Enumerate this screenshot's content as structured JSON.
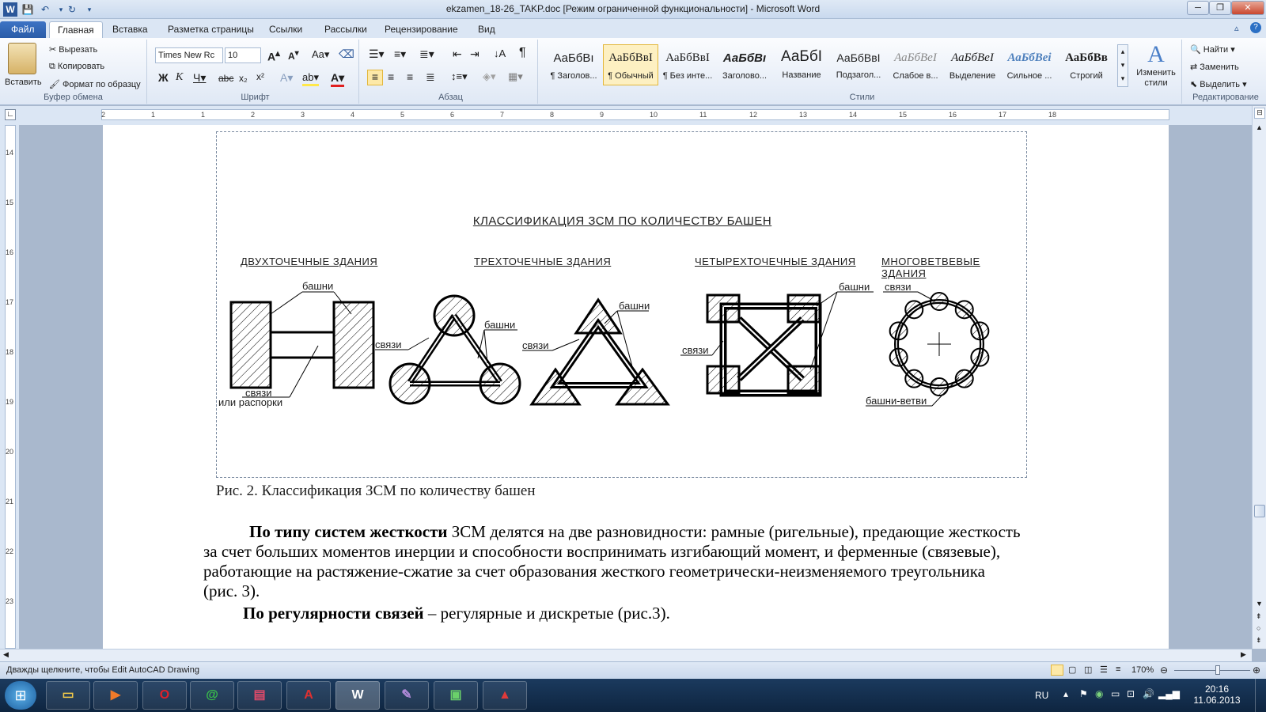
{
  "window": {
    "title": "ekzamen_18-26_TAKP.doc [Режим ограниченной функциональности]  -  Microsoft Word"
  },
  "tabs": [
    "Файл",
    "Главная",
    "Вставка",
    "Разметка страницы",
    "Ссылки",
    "Рассылки",
    "Рецензирование",
    "Вид"
  ],
  "clipboard": {
    "paste": "Вставить",
    "cut": "Вырезать",
    "copy": "Копировать",
    "format": "Формат по образцу",
    "label": "Буфер обмена"
  },
  "font": {
    "name": "Times New Rc",
    "size": "10",
    "label": "Шрифт"
  },
  "paragraph": {
    "label": "Абзац"
  },
  "styles": {
    "label": "Стили",
    "change": "Изменить стили",
    "items": [
      {
        "sample": "АаБбВı",
        "name": "¶ Заголов..."
      },
      {
        "sample": "АаБбВвI",
        "name": "¶ Обычный"
      },
      {
        "sample": "АаБбВвI",
        "name": "¶ Без инте..."
      },
      {
        "sample": "АаБбВı",
        "name": "Заголово..."
      },
      {
        "sample": "АаБбI",
        "name": "Название"
      },
      {
        "sample": "АаБбВвI",
        "name": "Подзагол..."
      },
      {
        "sample": "АаБбВеI",
        "name": "Слабое в..."
      },
      {
        "sample": "АаБбВеI",
        "name": "Выделение"
      },
      {
        "sample": "АаБбВеi",
        "name": "Сильное ..."
      },
      {
        "sample": "АаБбВв",
        "name": "Строгий"
      }
    ]
  },
  "editing": {
    "find": "Найти",
    "replace": "Заменить",
    "select": "Выделить",
    "label": "Редактирование"
  },
  "ruler": {
    "h": [
      "2",
      "1",
      "1",
      "2",
      "3",
      "4",
      "5",
      "6",
      "7",
      "8",
      "9",
      "10",
      "11",
      "12",
      "13",
      "14",
      "15",
      "16",
      "17",
      "18"
    ],
    "v": [
      "14",
      "15",
      "16",
      "17",
      "18",
      "19",
      "20",
      "21",
      "22",
      "23"
    ]
  },
  "figure": {
    "title": "КЛАССИФИКАЦИЯ ЗСМ ПО КОЛИЧЕСТВУ БАШЕН",
    "headings": [
      "ДВУХТОЧЕЧНЫЕ ЗДАНИЯ",
      "ТРЕХТОЧЕЧНЫЕ ЗДАНИЯ",
      "ЧЕТЫРЕХТОЧЕЧНЫЕ ЗДАНИЯ",
      "МНОГОВЕТВЕВЫЕ ЗДАНИЯ"
    ],
    "labels": {
      "towers": "башни",
      "links": "связи",
      "struts": "или распорки",
      "branches": "башни-ветви"
    }
  },
  "doc": {
    "caption": "Рис. 2. Классификация ЗСМ по количеству башен",
    "p1_bold": "По типу систем жесткости",
    "p1_l1": " ЗСМ делятся на две разновидности: рамные (ригельные), предающие жесткость",
    "p1_l2": "за счет больших моментов инерции и способности воспринимать изгибающий момент,  и ферменные (связевые),",
    "p1_l3": "работающие на растяжение-сжатие за счет образования жесткого геометрически-неизменяемого треугольника",
    "p1_l4": "(рис. 3).",
    "p2_bold": "По регулярности связей",
    "p2_text": " – регулярные и дискретые (рис.3)."
  },
  "status": {
    "text": "Дважды щелкните, чтобы Edit AutoCAD Drawing",
    "zoom": "170%"
  },
  "tray": {
    "lang": "RU",
    "time": "20:16",
    "date": "11.06.2013"
  }
}
